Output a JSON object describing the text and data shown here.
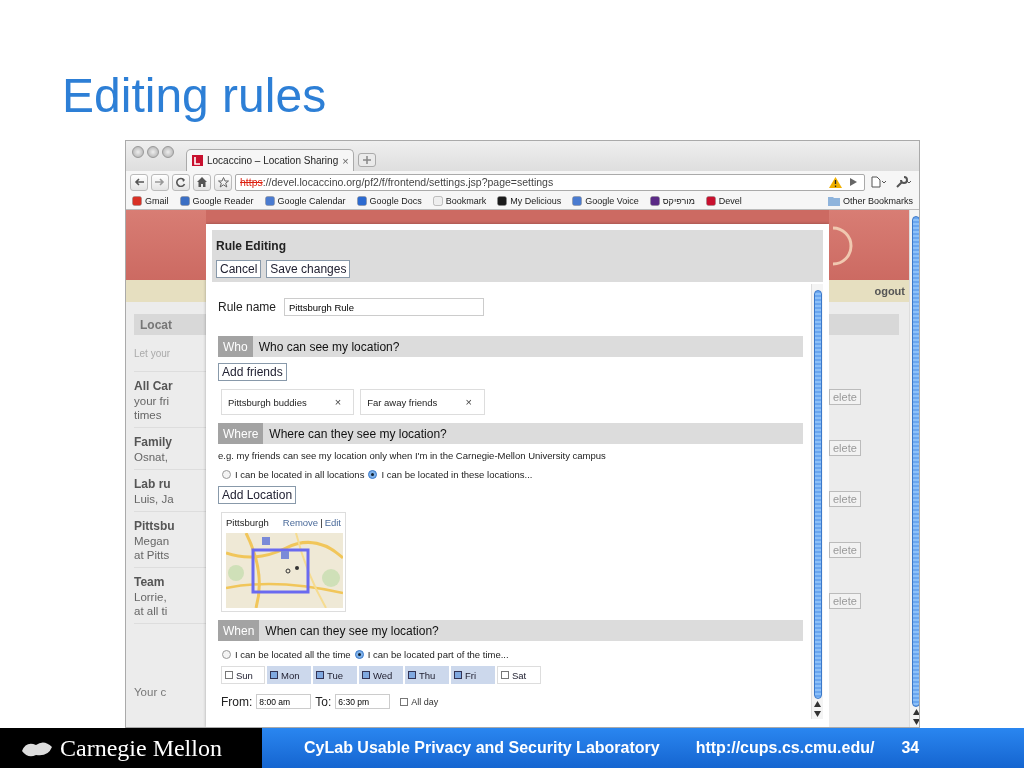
{
  "slide": {
    "title": "Editing rules",
    "footer": {
      "logo": "Carnegie Mellon",
      "lab": "CyLab Usable Privacy and Security Laboratory",
      "url": "http://cups.cs.cmu.edu/",
      "page": "34"
    }
  },
  "browser": {
    "tab_title": "Locaccino – Location Sharing",
    "tab_close": "×",
    "url_scheme": "https",
    "url_rest": "://devel.locaccino.org/pf2/f/frontend/settings.jsp?page=settings",
    "bookmarks": [
      {
        "label": "Gmail"
      },
      {
        "label": "Google Reader"
      },
      {
        "label": "Google Calendar"
      },
      {
        "label": "Google Docs"
      },
      {
        "label": "Bookmark"
      },
      {
        "label": "My Delicious"
      },
      {
        "label": "Google Voice"
      },
      {
        "label": "מורפיקס"
      },
      {
        "label": "Devel"
      }
    ],
    "other_bookmarks": "Other Bookmarks"
  },
  "page": {
    "left": {
      "section": "Locat",
      "intro": "Let your",
      "groups": [
        {
          "title": "All Car",
          "lines": [
            "your fri",
            "times"
          ]
        },
        {
          "title": "Family",
          "lines": [
            "Osnat,"
          ]
        },
        {
          "title": "Lab ru",
          "lines": [
            "Luis, Ja"
          ]
        },
        {
          "title": "Pittsbu",
          "lines": [
            "Megan",
            "at Pitts"
          ]
        },
        {
          "title": "Team",
          "lines": [
            "Lorrie,",
            "at all ti"
          ]
        }
      ],
      "footer": "Your c"
    },
    "right": {
      "logout": "ogout",
      "delete_buttons": [
        "elete",
        "elete",
        "elete",
        "elete",
        "elete"
      ]
    }
  },
  "dialog": {
    "title": "Rule Editing",
    "buttons": [
      "Cancel",
      "Save changes"
    ],
    "rule_name_label": "Rule name",
    "rule_name": "Pittsburgh Rule",
    "who": {
      "tag": "Who",
      "heading": "Who can see my location?",
      "add_button": "Add friends",
      "friends": [
        {
          "label": "Pittsburgh buddies",
          "remove": "×"
        },
        {
          "label": "Far away friends",
          "remove": "×"
        }
      ]
    },
    "where": {
      "tag": "Where",
      "heading": "Where can they see my location?",
      "hint": "e.g. my friends can see my location only when I'm in the Carnegie-Mellon University campus",
      "options": [
        {
          "label": "I can be located in all locations",
          "selected": false
        },
        {
          "label": "I can be located in these locations...",
          "selected": true
        }
      ],
      "add_button": "Add Location",
      "locations": [
        {
          "name": "Pittsburgh",
          "remove": "Remove",
          "separator": "|",
          "edit": "Edit"
        }
      ]
    },
    "when": {
      "tag": "When",
      "heading": "When can they see my location?",
      "options": [
        {
          "label": "I can be located all the time",
          "selected": false
        },
        {
          "label": "I can be located part of the time...",
          "selected": true
        }
      ],
      "days": [
        {
          "label": "Sun",
          "checked": false
        },
        {
          "label": "Mon",
          "checked": true
        },
        {
          "label": "Tue",
          "checked": true
        },
        {
          "label": "Wed",
          "checked": true
        },
        {
          "label": "Thu",
          "checked": true
        },
        {
          "label": "Fri",
          "checked": true
        },
        {
          "label": "Sat",
          "checked": false
        }
      ],
      "from_label": "From:",
      "from": "8:00 am",
      "to_label": "To:",
      "to": "6:30 pm",
      "all_day": {
        "label": "All day",
        "checked": false
      }
    }
  }
}
